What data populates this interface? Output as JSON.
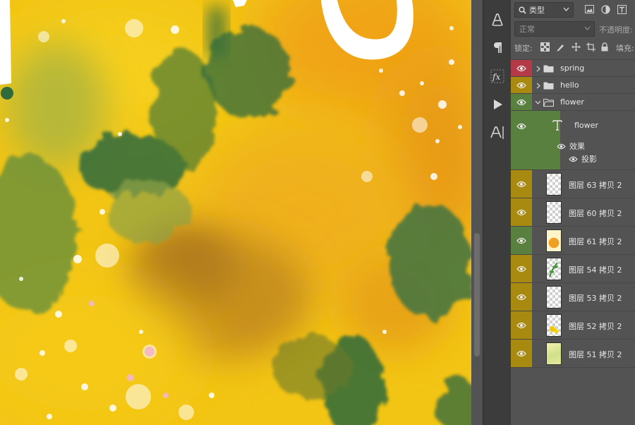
{
  "colors": {
    "red_tag": "#b43a48",
    "yellow_tag": "#a88a10",
    "green_tag": "#5a8040",
    "panel_bg": "#535353",
    "toolstrip_bg": "#3c3c3c"
  },
  "filter": {
    "search_icon": "search-icon",
    "kind_label": "类型"
  },
  "blend": {
    "mode": "正常",
    "opacity_label": "不透明度:"
  },
  "lock": {
    "label": "锁定:",
    "fill_label": "填充:"
  },
  "tools": [
    "character-panel-icon",
    "paragraph-icon",
    "fx-icon",
    "play-icon",
    "glyphs-icon"
  ],
  "layers": [
    {
      "name": "spring",
      "type": "group",
      "tag": "red",
      "expanded": false
    },
    {
      "name": "hello",
      "type": "group",
      "tag": "yellow",
      "expanded": false
    },
    {
      "name": "flower",
      "type": "group",
      "tag": "green",
      "expanded": true
    },
    {
      "name": "flower",
      "type": "text",
      "tag": "green"
    },
    {
      "effects_label": "效果",
      "effect_item": "投影"
    },
    {
      "name": "图层 63 拷贝 2",
      "type": "pixel",
      "tag": "yellow",
      "thumb": "transparent"
    },
    {
      "name": "图层 60 拷贝 2",
      "type": "pixel",
      "tag": "yellow",
      "thumb": "transparent"
    },
    {
      "name": "图层 61 拷贝 2",
      "type": "pixel",
      "tag": "green",
      "thumb": "orange-flower"
    },
    {
      "name": "图层 54 拷贝 2",
      "type": "pixel",
      "tag": "yellow",
      "thumb": "green-leaf"
    },
    {
      "name": "图层 53 拷贝 2",
      "type": "pixel",
      "tag": "yellow",
      "thumb": "transparent"
    },
    {
      "name": "图层 52 拷贝 2",
      "type": "pixel",
      "tag": "yellow",
      "thumb": "yellow-flower"
    },
    {
      "name": "图层 51 拷贝 2",
      "type": "pixel",
      "tag": "yellow",
      "thumb": "yellow-green"
    }
  ]
}
